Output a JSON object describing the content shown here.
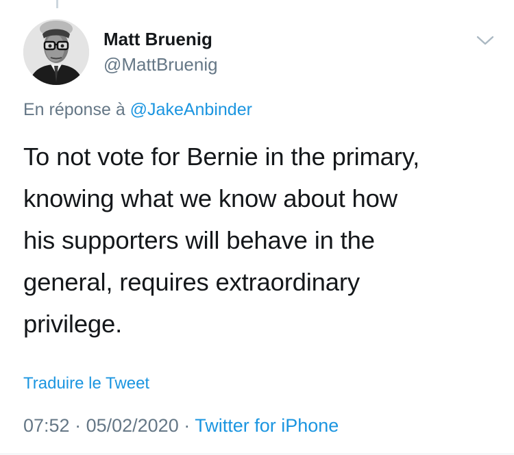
{
  "author": {
    "name": "Matt Bruenig",
    "handle": "@MattBruenig",
    "avatar_icon": "portrait-photo"
  },
  "menu": {
    "icon": "chevron-down-icon"
  },
  "reply": {
    "prefix": "En réponse à ",
    "mention": "@JakeAnbinder"
  },
  "tweet": {
    "lines": [
      "To not vote for Bernie in the primary,",
      "knowing what we know about how",
      "his supporters will behave in the",
      "general, requires extraordinary",
      "privilege."
    ]
  },
  "translate_label": "Traduire le Tweet",
  "meta": {
    "time": "07:52",
    "separator": " · ",
    "date": "05/02/2020",
    "source": "Twitter for iPhone"
  },
  "colors": {
    "text": "#14171a",
    "secondary": "#657786",
    "link": "#1b95e0"
  }
}
